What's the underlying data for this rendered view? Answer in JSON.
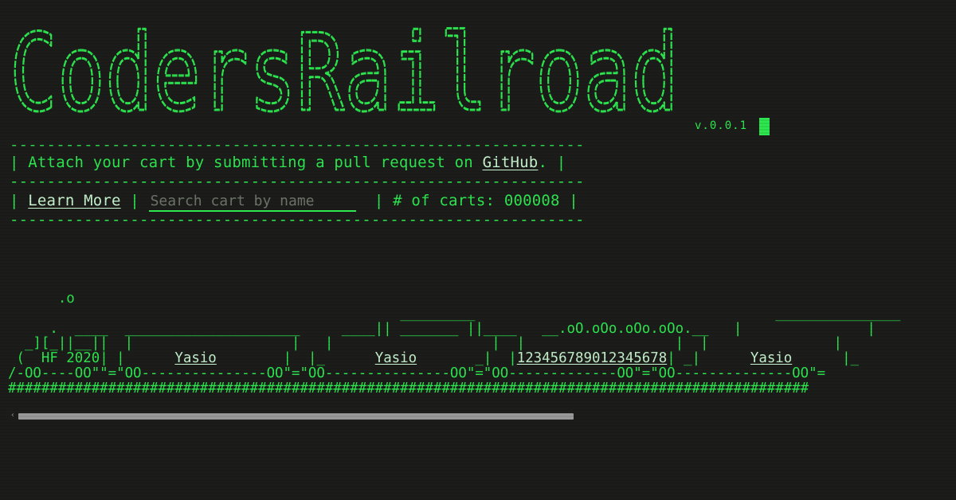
{
  "logo": {
    "name": "CodersRailroad",
    "version": "v.0.0.1"
  },
  "info": {
    "divider": "--------------------------------------------------------------",
    "attach_prefix": "| Attach your cart by submitting a pull request on ",
    "github_link": "GitHub",
    "attach_suffix": ". |",
    "learn_more": "Learn More",
    "search_placeholder": "Search cart by name",
    "cart_count_label": "# of carts:",
    "cart_count": "000008"
  },
  "train": {
    "engine": {
      "label": "HF 2020",
      "smoke": ".o"
    },
    "carts": [
      {
        "name": "Yasio"
      },
      {
        "name": "Yasio"
      },
      {
        "name": "123456789012345678"
      },
      {
        "name": "Yasio"
      }
    ],
    "track": "################################################################################################"
  },
  "colors": {
    "background": "#1c1d1b",
    "terminal_green": "#2ee84f",
    "link_text": "#c8f5cf",
    "placeholder": "#6e766c",
    "scrollbar": "#9a9a9a"
  },
  "icons": {
    "scroll_left": "scroll-left-arrow-icon"
  }
}
